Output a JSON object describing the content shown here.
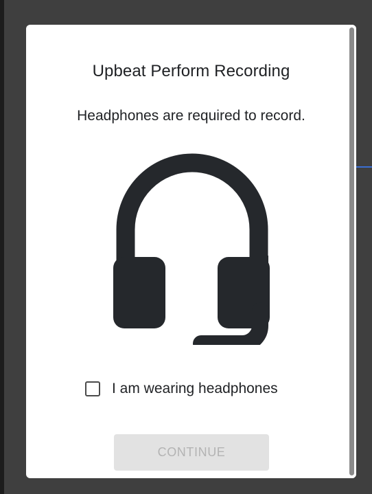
{
  "dialog": {
    "title": "Upbeat Perform Recording",
    "message": "Headphones are required to record.",
    "icon": "headset-icon",
    "checkbox": {
      "label": "I am wearing headphones",
      "checked": false
    },
    "continue_label": "CONTINUE",
    "continue_enabled": false
  },
  "colors": {
    "backdrop": "#3f3f3f",
    "panel": "#ffffff",
    "text": "#1f2124",
    "icon": "#25282c",
    "button_disabled_bg": "#e2e2e2",
    "button_disabled_text": "#b3b3b3",
    "accent_line": "#3b6fd4"
  }
}
